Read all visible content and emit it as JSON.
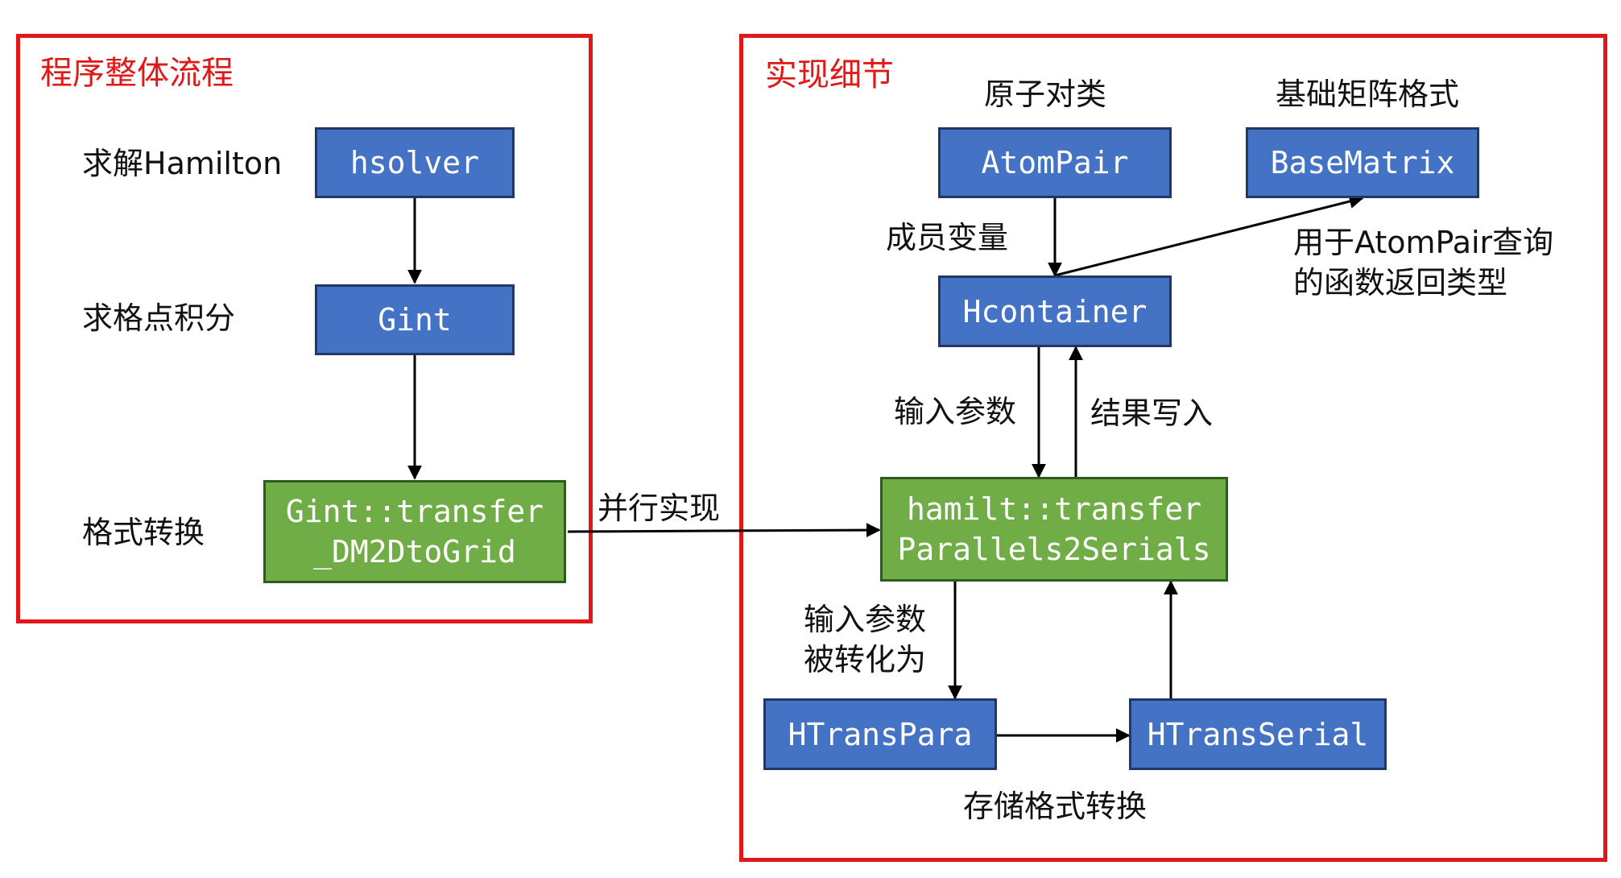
{
  "colors": {
    "frame": "#e01818",
    "node_blue": "#4472c4",
    "node_green": "#70ad47",
    "edge": "#000000"
  },
  "left_panel": {
    "title": "程序整体流程",
    "row_labels": [
      "求解Hamilton",
      "求格点积分",
      "格式转换"
    ],
    "nodes": {
      "hsolver": "hsolver",
      "gint": "Gint",
      "gint_transfer": "Gint::transfer\n_DM2DtoGrid"
    }
  },
  "bridge_label": "并行实现",
  "right_panel": {
    "title": "实现细节",
    "headers": {
      "atompair": "原子对类",
      "basematrix": "基础矩阵格式"
    },
    "nodes": {
      "atompair": "AtomPair",
      "basematrix": "BaseMatrix",
      "hcontainer": "Hcontainer",
      "hamilt_transfer": "hamilt::transfer\nParallels2Serials",
      "htranspara": "HTransPara",
      "htransserial": "HTransSerial"
    },
    "edge_labels": {
      "member_var": "成员变量",
      "basematrix_use": "用于AtomPair查询\n的函数返回类型",
      "input_params": "输入参数",
      "result_write": "结果写入",
      "input_converted": "输入参数\n被转化为",
      "storage_convert": "存储格式转换"
    }
  }
}
